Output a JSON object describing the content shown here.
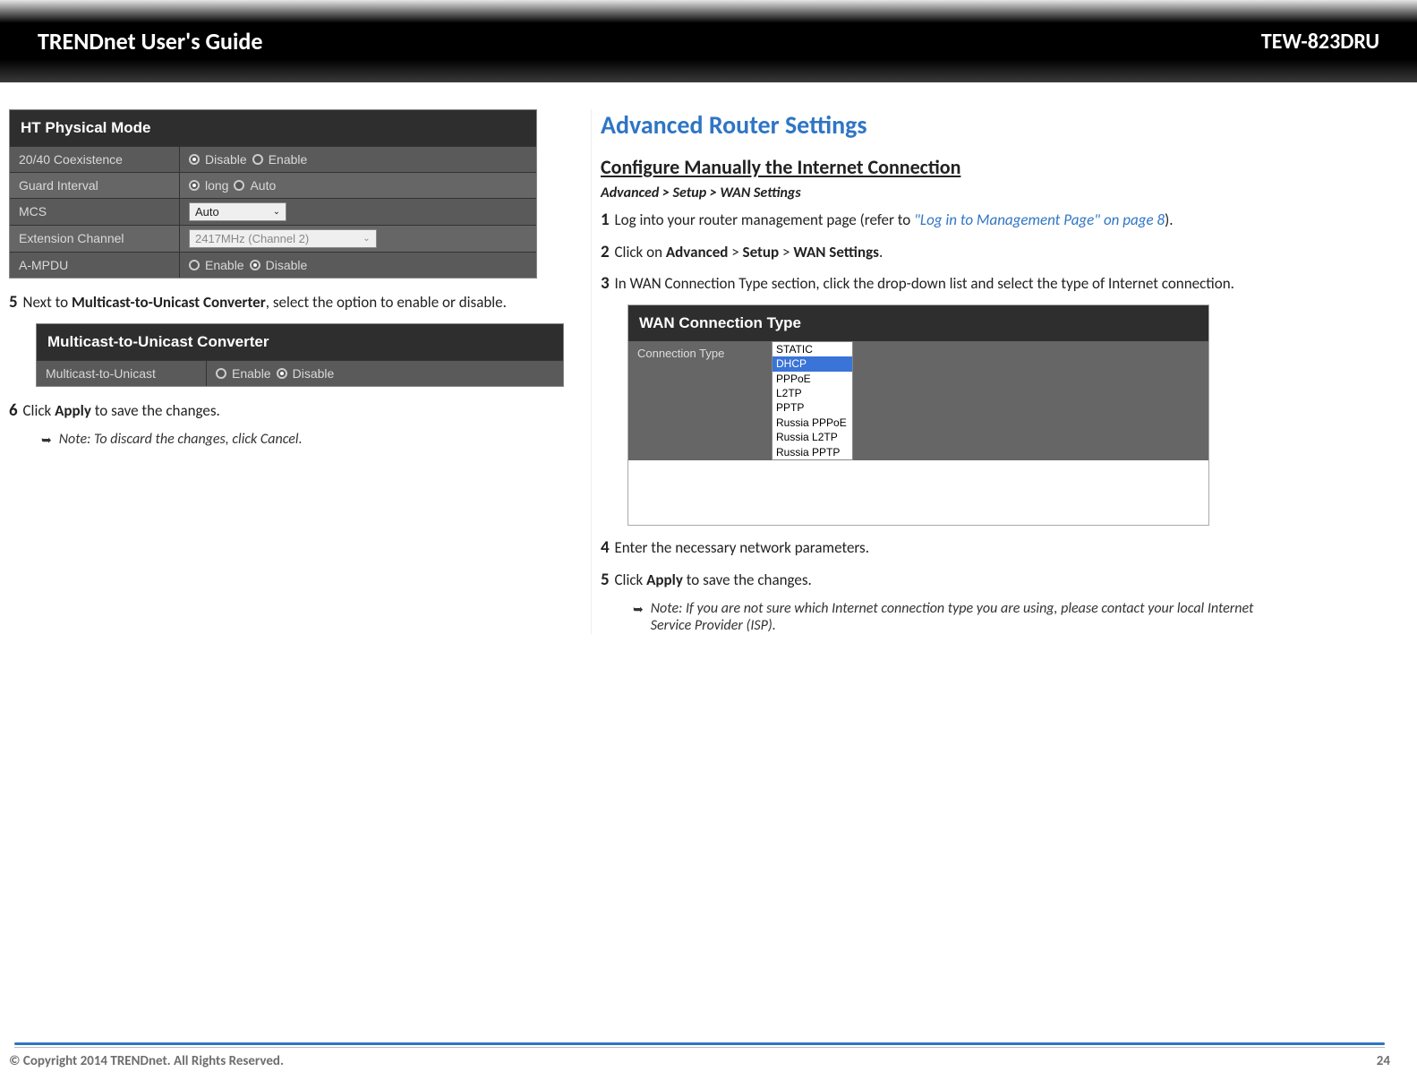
{
  "banner": {
    "left": "TRENDnet User's Guide",
    "right": "TEW-823DRU"
  },
  "htTable": {
    "title": "HT Physical Mode",
    "rows": {
      "coex_label": "20/40 Coexistence",
      "coex_opt1": "Disable",
      "coex_opt2": "Enable",
      "guard_label": "Guard Interval",
      "guard_opt1": "long",
      "guard_opt2": "Auto",
      "mcs_label": "MCS",
      "mcs_value": "Auto",
      "ext_label": "Extension Channel",
      "ext_value": "2417MHz (Channel 2)",
      "ampdu_label": "A-MPDU",
      "ampdu_opt1": "Enable",
      "ampdu_opt2": "Disable"
    }
  },
  "step5": {
    "num": "5",
    "pre": " Next to ",
    "bold": "Multicast-to-Unicast Converter",
    "post": ", select the option to enable or disable."
  },
  "mcTable": {
    "title": "Multicast-to-Unicast Converter",
    "row_label": "Multicast-to-Unicast",
    "opt1": "Enable",
    "opt2": "Disable"
  },
  "step6": {
    "num": "6",
    "pre": " Click ",
    "bold": "Apply",
    "post": " to save the changes."
  },
  "note_left": "Note: To discard the changes, click Cancel.",
  "right": {
    "h1": "Advanced Router Settings",
    "h2": "Configure Manually the Internet Connection",
    "path": "Advanced > Setup > WAN Settings",
    "s1": {
      "num": "1",
      "a": " Log into your router management page (refer to ",
      "link": "\"Log in to Management Page\" on page 8",
      "b": ")."
    },
    "s2": {
      "num": "2",
      "a": " Click on ",
      "b1": "Advanced",
      "gt1": " > ",
      "b2": "Setup",
      "gt2": " > ",
      "b3": "WAN Settings",
      "end": "."
    },
    "s3": {
      "num": "3",
      "a": " In WAN Connection Type section, click the drop-down list and select the type of Internet connection."
    },
    "wan": {
      "title": "WAN Connection Type",
      "label": "Connection Type",
      "opts": [
        "STATIC",
        "DHCP",
        "PPPoE",
        "L2TP",
        "PPTP",
        "Russia PPPoE",
        "Russia L2TP",
        "Russia PPTP"
      ],
      "selected": "DHCP"
    },
    "s4": {
      "num": "4",
      "a": "  Enter the necessary network parameters."
    },
    "s5": {
      "num": "5",
      "a": " Click ",
      "b": "Apply",
      "c": " to save the changes."
    },
    "note": "Note: If you are not sure which Internet connection type you are using, please contact your local Internet Service Provider (ISP)."
  },
  "footer": {
    "copy": "© Copyright 2014 TRENDnet. All Rights Reserved.",
    "page": "24"
  }
}
